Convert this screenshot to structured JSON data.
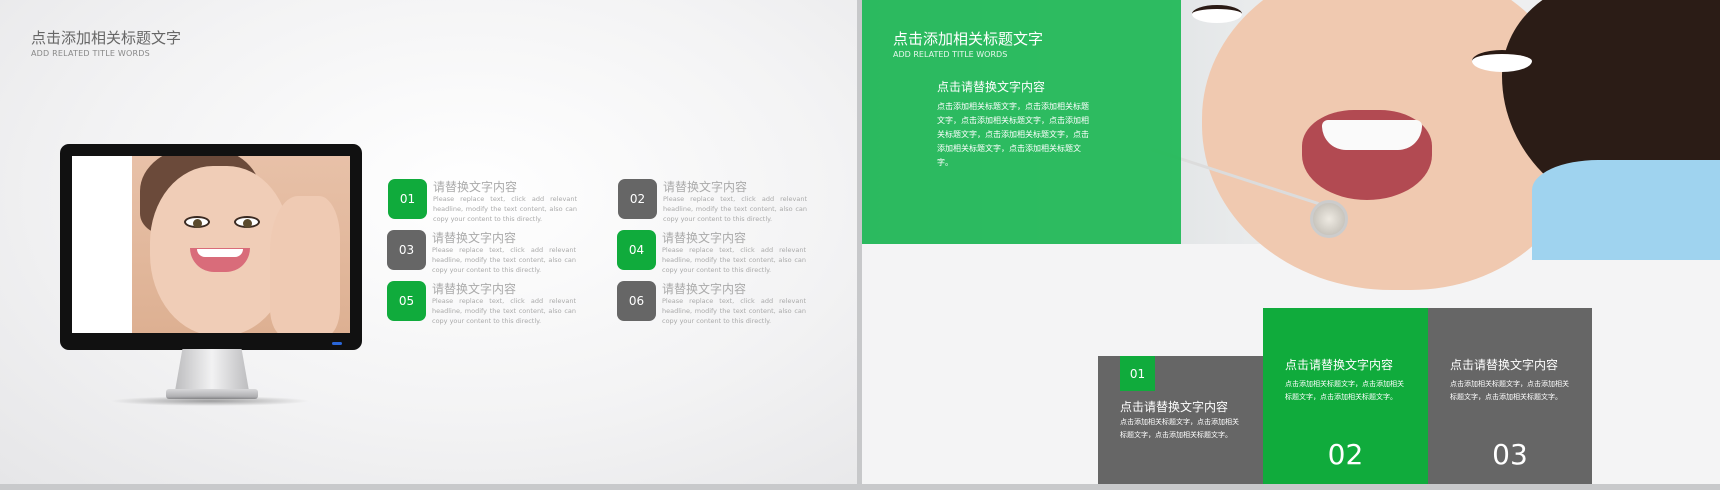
{
  "left_slide": {
    "title": "点击添加相关标题文字",
    "subtitle": "ADD RELATED TITLE WORDS",
    "items": [
      {
        "num": "01",
        "title": "请替换文字内容",
        "desc": "Please replace text, click add relevant headline, modify the text content, also can copy your content to this directly."
      },
      {
        "num": "02",
        "title": "请替换文字内容",
        "desc": "Please replace text, click add relevant headline, modify the text content, also can copy your content to this directly."
      },
      {
        "num": "03",
        "title": "请替换文字内容",
        "desc": "Please replace text, click add relevant headline, modify the text content, also can copy your content to this directly."
      },
      {
        "num": "04",
        "title": "请替换文字内容",
        "desc": "Please replace text, click add relevant headline, modify the text content, also can copy your content to this directly."
      },
      {
        "num": "05",
        "title": "请替换文字内容",
        "desc": "Please replace text, click add relevant headline, modify the text content, also can copy your content to this directly."
      },
      {
        "num": "06",
        "title": "请替换文字内容",
        "desc": "Please replace text, click add relevant headline, modify the text content, also can copy your content to this directly."
      }
    ]
  },
  "right_slide": {
    "title": "点击添加相关标题文字",
    "subtitle": "ADD RELATED TITLE WORDS",
    "panel_heading": "点击请替换文字内容",
    "panel_body": "点击添加相关标题文字，点击添加相关标题文字，点击添加相关标题文字，点击添加相关标题文字，点击添加相关标题文字，点击添加相关标题文字，点击添加相关标题文字。",
    "cards": [
      {
        "num": "01",
        "title": "点击请替换文字内容",
        "body": "点击添加相关标题文字，点击添加相关标题文字，点击添加相关标题文字。"
      },
      {
        "num": "02",
        "title": "点击请替换文字内容",
        "body": "点击添加相关标题文字，点击添加相关标题文字，点击添加相关标题文字。"
      },
      {
        "num": "03",
        "title": "点击请替换文字内容",
        "body": "点击添加相关标题文字，点击添加相关标题文字，点击添加相关标题文字。"
      }
    ]
  },
  "colors": {
    "accent_green": "#10ab3c",
    "panel_green": "#1fb856",
    "card_gray": "#666666"
  }
}
